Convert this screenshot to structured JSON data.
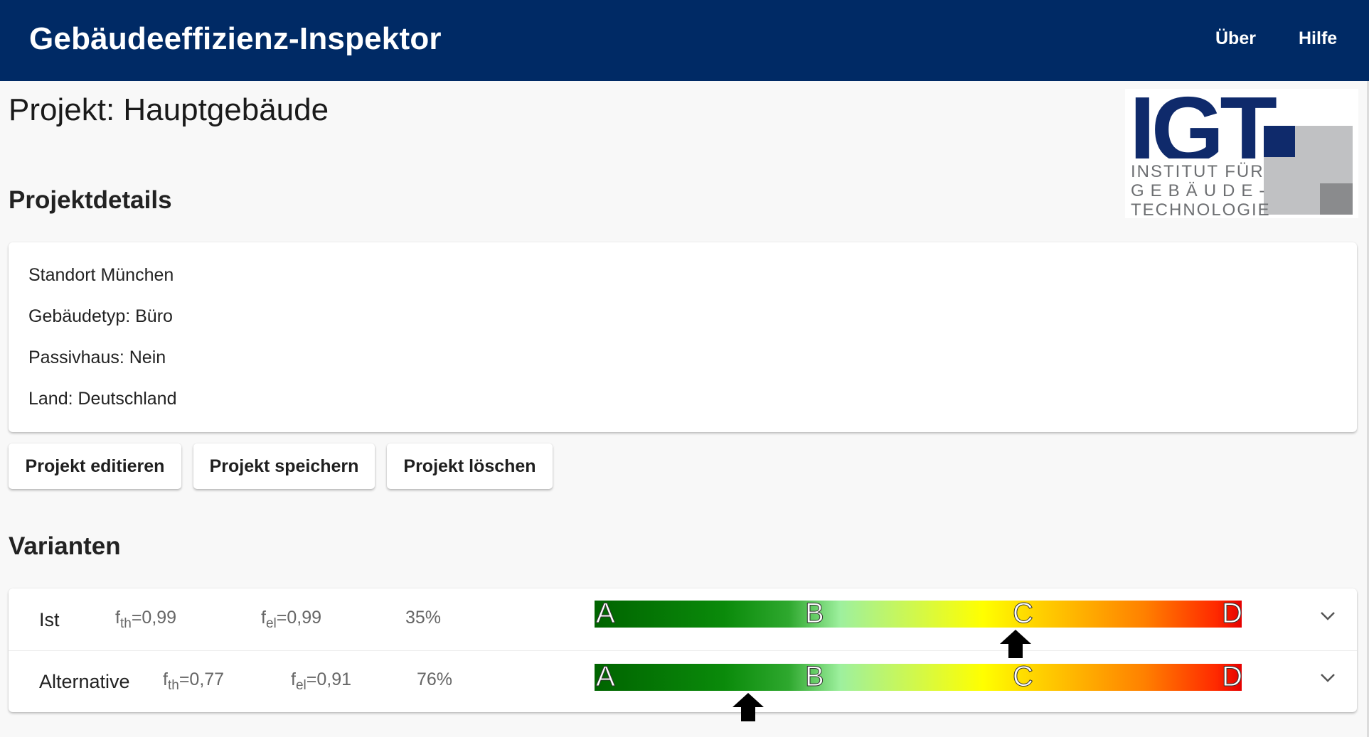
{
  "header": {
    "title": "Gebäudeeffizienz-Inspektor",
    "nav": {
      "about": "Über",
      "help": "Hilfe"
    }
  },
  "project": {
    "title": "Projekt: Hauptgebäude"
  },
  "logo": {
    "letters": "IGT",
    "line1": "INSTITUT FÜR",
    "line2": "GEBÄUDE-",
    "line3": "TECHNOLOGIE",
    "colors": {
      "blue": "#0f2a6b",
      "grey": "#c0c1c3",
      "dark_grey": "#8a8b8d"
    }
  },
  "details": {
    "heading": "Projektdetails",
    "lines": [
      "Standort München",
      "Gebäudetyp: Büro",
      "Passivhaus: Nein",
      "Land: Deutschland"
    ]
  },
  "buttons": {
    "edit": "Projekt editieren",
    "save": "Projekt speichern",
    "delete": "Projekt löschen"
  },
  "variants": {
    "heading": "Varianten",
    "scale_letters": [
      "A",
      "B",
      "C",
      "D"
    ],
    "rows": [
      {
        "name": "Ist",
        "fth_label": "f",
        "fth_sub": "th",
        "fth_value": "=0,99",
        "fel_label": "f",
        "fel_sub": "el",
        "fel_value": "=0,99",
        "percent": "35%",
        "rating_position": 0.65
      },
      {
        "name": "Alternative",
        "fth_label": "f",
        "fth_sub": "th",
        "fth_value": "=0,77",
        "fel_label": "f",
        "fel_sub": "el",
        "fel_value": "=0,91",
        "percent": "76%",
        "rating_position": 0.237
      }
    ]
  },
  "colors": {
    "header_bg": "#002a65",
    "scale": [
      "#006400",
      "#9ef09e",
      "#ffff00",
      "#ff8000",
      "#e60000"
    ]
  }
}
